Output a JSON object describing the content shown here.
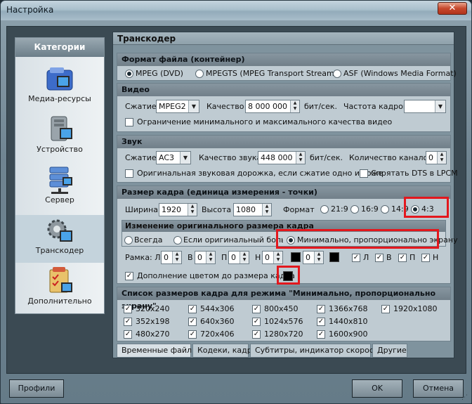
{
  "window": {
    "title": "Настройка",
    "close": "✕"
  },
  "sidebar": {
    "header": "Категории",
    "items": [
      {
        "label": "Медиа-ресурсы"
      },
      {
        "label": "Устройство"
      },
      {
        "label": "Сервер"
      },
      {
        "label": "Транскодер"
      },
      {
        "label": "Дополнительно"
      }
    ]
  },
  "panel": {
    "title": "Транскодер"
  },
  "format": {
    "title": "Формат файла (контейнер)",
    "options": [
      "MPEG (DVD)",
      "MPEGTS (MPEG Transport Stream)",
      "ASF (Windows Media Format)"
    ]
  },
  "video": {
    "title": "Видео",
    "compress_label": "Сжатие",
    "compress_value": "MPEG2",
    "quality_label": "Качество",
    "quality_value": "8 000 000",
    "quality_unit": "бит/сек.",
    "fps_label": "Частота кадров",
    "fps_value": "",
    "limit_label": "Ограничение минимального и максимального качества видео"
  },
  "audio": {
    "title": "Звук",
    "compress_label": "Сжатие",
    "compress_value": "AC3",
    "quality_label": "Качество звука",
    "quality_value": "448 000",
    "quality_unit": "бит/сек.",
    "channels_label": "Количество каналов",
    "channels_value": "0",
    "original_label": "Оригинальная звуковая дорожка, если сжатие одно и тоже",
    "hide_dts_label": "Спрятать DTS в LPCM"
  },
  "frame": {
    "title": "Размер кадра (единица измерения - точки)",
    "width_label": "Ширина",
    "width_value": "1920",
    "height_label": "Высота",
    "height_value": "1080",
    "format_label": "Формат",
    "aspects": [
      "21:9",
      "16:9",
      "14:9",
      "4:3"
    ],
    "resize": {
      "title": "Изменение оригинального размера кадра",
      "always": "Всегда",
      "if_larger": "Если оригинальный больше",
      "minimal": "Минимально, пропорционально экрану"
    },
    "border_label": "Рамка: Л",
    "border_fields": [
      {
        "prefix": "",
        "value": "0"
      },
      {
        "prefix": "В",
        "value": "0"
      },
      {
        "prefix": "П",
        "value": "0"
      },
      {
        "prefix": "Н",
        "value": "0"
      }
    ],
    "border_extra": "0",
    "border_checks": [
      "Л",
      "В",
      "П",
      "Н"
    ],
    "fill_label": "Дополнение цветом до размера кадра"
  },
  "sizes": {
    "title": "Список размеров кадра для режима \"Минимально, пропорционально экрану\"",
    "items": [
      "320x240",
      "544x306",
      "800x450",
      "1366x768",
      "1920x1080",
      "352x198",
      "640x360",
      "1024x576",
      "1440x810",
      "480x270",
      "720x406",
      "1280x720",
      "1600x900"
    ]
  },
  "tabs": [
    "Временные файлы",
    "Кодеки, кадр",
    "Субтитры, индикатор скорости",
    "Другие"
  ],
  "buttons": {
    "profiles": "Профили",
    "ok": "OK",
    "cancel": "Отмена"
  },
  "colors": {
    "highlight": "#e3171d",
    "fill_color": "#000000"
  }
}
